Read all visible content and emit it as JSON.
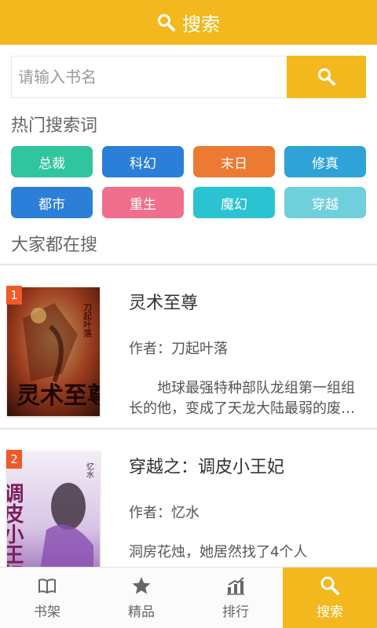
{
  "header": {
    "title": "搜索",
    "icon": "search-icon"
  },
  "search": {
    "placeholder": "请输入书名",
    "value": "",
    "button_icon": "search-icon"
  },
  "hot": {
    "title": "热门搜索词",
    "tags": [
      {
        "label": "总裁",
        "color": "#2fc59e"
      },
      {
        "label": "科幻",
        "color": "#2b7fd9"
      },
      {
        "label": "末日",
        "color": "#ec7a33"
      },
      {
        "label": "修真",
        "color": "#2fa3d8"
      },
      {
        "label": "都市",
        "color": "#2b7fd9"
      },
      {
        "label": "重生",
        "color": "#ef6f8d"
      },
      {
        "label": "魔幻",
        "color": "#2ac3d1"
      },
      {
        "label": "穿越",
        "color": "#6fcfda"
      }
    ]
  },
  "popular": {
    "title": "大家都在搜",
    "books": [
      {
        "rank": "1",
        "title": "灵术至尊",
        "author": "作者：刀起叶落",
        "desc": "地球最强特种部队龙组第一组组长的他，变成了天龙大陆最弱的废材……",
        "cover_text": "灵术至尊",
        "cover_author": "刀起叶落"
      },
      {
        "rank": "2",
        "title": "穿越之：调皮小王妃",
        "author": "作者：忆水",
        "desc": "洞房花烛，她居然找了4个人",
        "cover_text": "调皮小王妃",
        "cover_author": "忆水"
      }
    ]
  },
  "tabbar": {
    "items": [
      {
        "label": "书架",
        "icon": "book-icon",
        "active": false
      },
      {
        "label": "精品",
        "icon": "star-icon",
        "active": false
      },
      {
        "label": "排行",
        "icon": "chart-icon",
        "active": false
      },
      {
        "label": "搜索",
        "icon": "search-icon",
        "active": true
      }
    ]
  },
  "colors": {
    "accent": "#f2b81d",
    "rank_badge": "#ef5a28"
  }
}
